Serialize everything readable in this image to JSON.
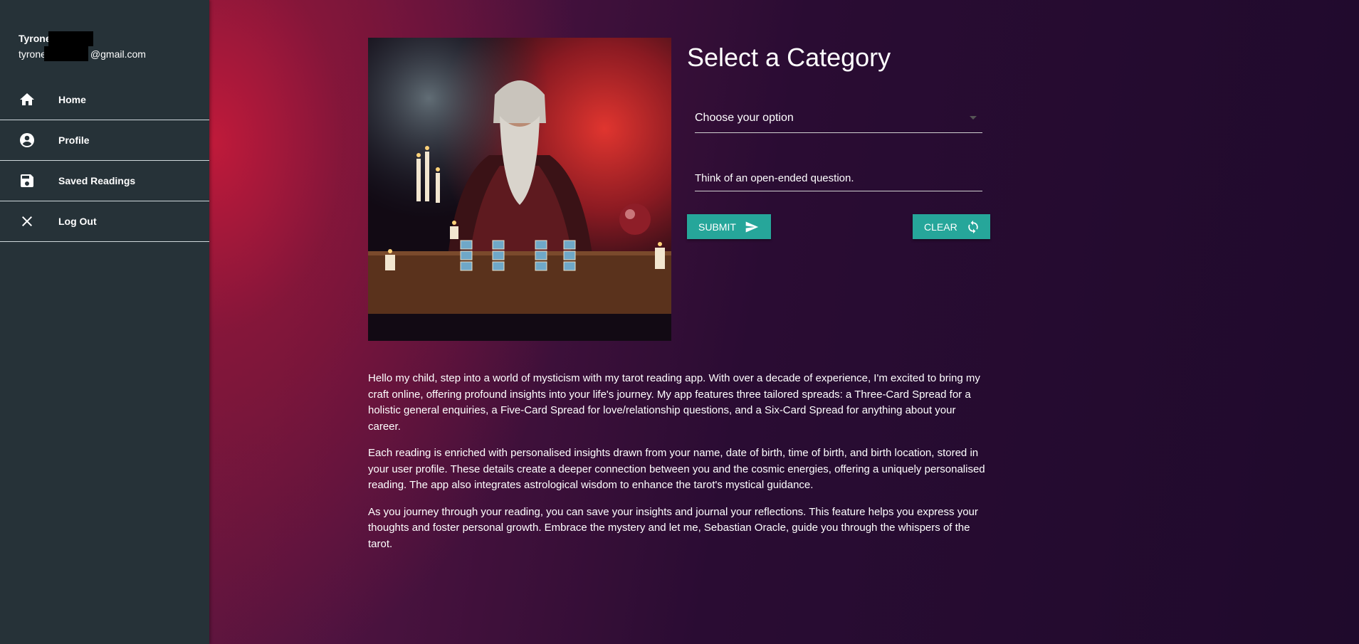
{
  "user": {
    "name": "Tyrone",
    "email_prefix": "tyrone",
    "email_suffix": "@gmail.com"
  },
  "nav": {
    "items": [
      {
        "label": "Home",
        "icon": "home-icon"
      },
      {
        "label": "Profile",
        "icon": "account-circle-icon"
      },
      {
        "label": "Saved Readings",
        "icon": "save-icon"
      },
      {
        "label": "Log Out",
        "icon": "close-icon"
      }
    ]
  },
  "form": {
    "title": "Select a Category",
    "category_select": "Choose your option",
    "question_placeholder": "Think of an open-ended question.",
    "submit_label": "SUBMIT",
    "clear_label": "CLEAR"
  },
  "description": {
    "paragraphs": [
      "Hello my child, step into a world of mysticism with my tarot reading app. With over a decade of experience, I'm excited to bring my craft online, offering profound insights into your life's journey. My app features three tailored spreads: a Three-Card Spread for a holistic general enquiries, a Five-Card Spread for love/relationship questions, and a Six-Card Spread for anything about your career.",
      "Each reading is enriched with personalised insights drawn from your name, date of birth, time of birth, and birth location, stored in your user profile. These details create a deeper connection between you and the cosmic energies, offering a uniquely personalised reading. The app also integrates astrological wisdom to enhance the tarot's mystical guidance.",
      "As you journey through your reading, you can save your insights and journal your reflections. This feature helps you express your thoughts and foster personal growth. Embrace the mystery and let me, Sebastian Oracle, guide you through the whispers of the tarot."
    ]
  },
  "colors": {
    "sidebar": "#263238",
    "accent": "#26a69a",
    "background_red": "#c41a3a",
    "background_dark": "#1f0a2c"
  }
}
